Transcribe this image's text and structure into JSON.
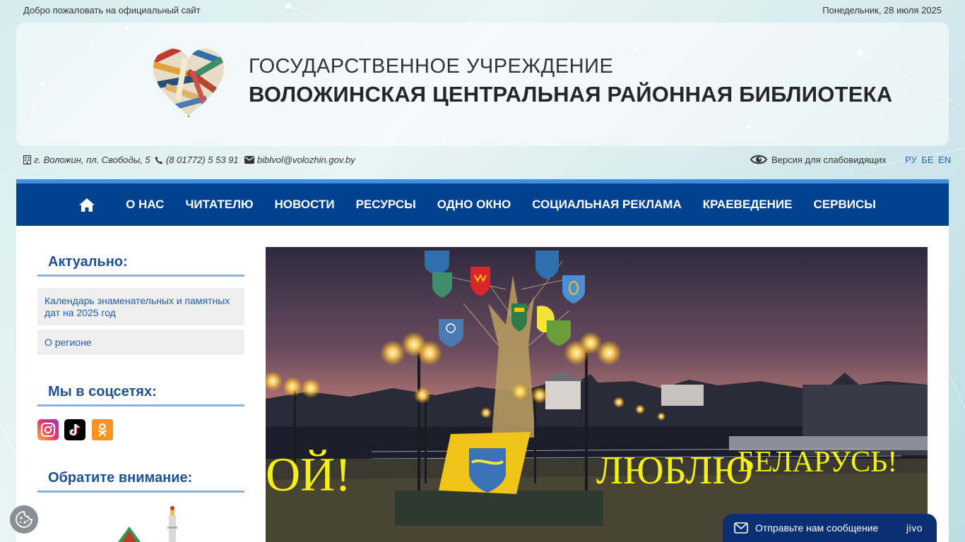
{
  "topbar": {
    "welcome": "Добро пожаловать на официальный сайт",
    "date": "Понедельник, 28 июля 2025"
  },
  "header": {
    "title_line1": "ГОСУДАРСТВЕННОЕ УЧРЕЖДЕНИЕ",
    "title_line2": "ВОЛОЖИНСКАЯ ЦЕНТРАЛЬНАЯ РАЙОННАЯ БИБЛИОТЕКА"
  },
  "contacts": {
    "address": "г. Воложин, пл. Свободы, 5",
    "phone": "(8 01772) 5 53 91",
    "email": "biblvol@volozhin.gov.by"
  },
  "accessibility": {
    "label": "Версия для слабовидящих"
  },
  "langs": [
    "РУ",
    "БЕ",
    "EN"
  ],
  "nav": {
    "items": [
      "О НАС",
      "ЧИТАТЕЛЮ",
      "НОВОСТИ",
      "РЕСУРСЫ",
      "ОДНО ОКНО",
      "СОЦИАЛЬНАЯ РЕКЛАМА",
      "КРАЕВЕДЕНИЕ",
      "СЕРВИСЫ"
    ]
  },
  "sidebar": {
    "actual_title": "Актуально:",
    "actual_links": [
      "Календарь знаменательных и памятных дат на 2025 год",
      "О регионе"
    ],
    "social_title": "Мы в соцсетях:",
    "attention_title": "Обратите внимание:"
  },
  "slider": {
    "sign_left": "ОЙ!",
    "sign_love": "ЛЮБЛЮ",
    "sign_country": "БЕЛАРУСЬ!"
  },
  "chat": {
    "label": "Отправьте нам сообщение",
    "brand": "jivo"
  },
  "colors": {
    "nav_bg": "#00428f",
    "nav_top_stripe": "#3f8fe0",
    "sidebar_heading": "#1f4f97",
    "link": "#1f5aa8",
    "chat_bg": "#0a2f73"
  }
}
